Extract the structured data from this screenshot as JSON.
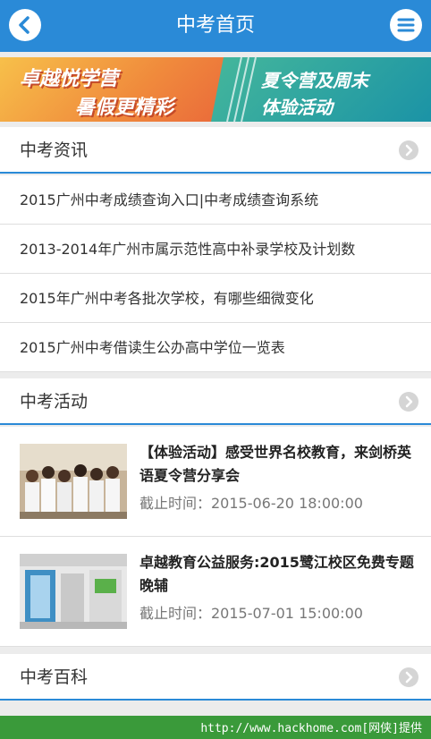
{
  "header": {
    "title": "中考首页"
  },
  "banner": {
    "line1": "卓越悦学营",
    "line2": "暑假更精彩",
    "line3": "夏令营及周末",
    "line4": "体验活动"
  },
  "sections": {
    "news": {
      "label": "中考资讯"
    },
    "activity": {
      "label": "中考活动"
    },
    "wiki": {
      "label": "中考百科"
    }
  },
  "news_items": [
    "2015广州中考成绩查询入口|中考成绩查询系统",
    "2013-2014年广州市属示范性高中补录学校及计划数",
    "2015年广州中考各批次学校，有哪些细微变化",
    "2015广州中考借读生公办高中学位一览表"
  ],
  "activities": [
    {
      "title": "【体验活动】感受世界名校教育，来剑桥英语夏令营分享会",
      "deadline": "截止时间：2015-06-20 18:00:00"
    },
    {
      "title": "卓越教育公益服务:2015鹭江校区免费专题晚辅",
      "deadline": "截止时间：2015-07-01 15:00:00"
    }
  ],
  "footer": {
    "text": "http://www.hackhome.com[网侠]提供"
  },
  "colors": {
    "primary": "#2a8ad7",
    "footer": "#3a9a3a"
  },
  "icons": {
    "back": "chevron-left-icon",
    "menu": "menu-icon",
    "more": "chevron-right-icon"
  }
}
